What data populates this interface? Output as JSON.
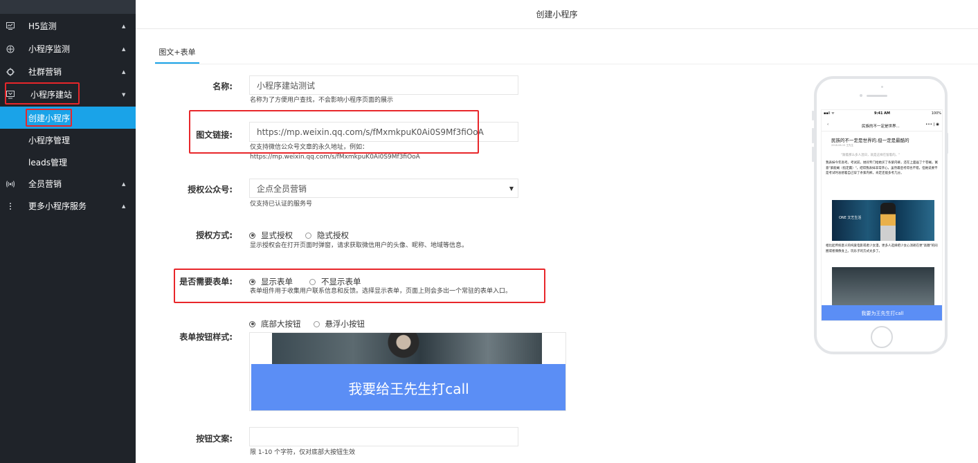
{
  "sidebar": {
    "items": [
      {
        "label": "H5监测",
        "icon": "monitor-chart-icon"
      },
      {
        "label": "小程序监测",
        "icon": "crosshair-icon"
      },
      {
        "label": "社群营销",
        "icon": "community-icon"
      },
      {
        "label": "小程序建站",
        "icon": "screen-icon"
      },
      {
        "label": "全员营销",
        "icon": "broadcast-icon"
      },
      {
        "label": "更多小程序服务",
        "icon": "more-vertical-icon"
      }
    ],
    "subitems": [
      {
        "label": "创建小程序",
        "active": true
      },
      {
        "label": "小程序管理",
        "active": false
      },
      {
        "label": "leads管理",
        "active": false
      }
    ],
    "active_color": "#1aa3e8",
    "highlight_color": "#e8262a"
  },
  "header": {
    "title": "创建小程序"
  },
  "tabs": [
    {
      "label": "图文+表单",
      "active": true
    }
  ],
  "form": {
    "name": {
      "label": "名称:",
      "value": "小程序建站测试",
      "hint": "名称为了方便用户查找，不会影响小程序页面的展示"
    },
    "link": {
      "label": "图文链接:",
      "value": "https://mp.weixin.qq.com/s/fMxmkpuK0Ai0S9Mf3fiOoA",
      "hint1": "仅支持微信公众号文章的永久地址，例如：",
      "hint2": "https://mp.weixin.qq.com/s/fMxmkpuK0Ai0S9Mf3fiOoA"
    },
    "account": {
      "label": "授权公众号:",
      "value": "企点全员营销",
      "hint": "仅支持已认证的服务号"
    },
    "auth_mode": {
      "label": "授权方式:",
      "options": [
        "显式授权",
        "隐式授权"
      ],
      "selected": "显式授权",
      "hint": "显示授权会在打开页面时弹窗，请求获取微信用户的头像、昵称、地域等信息。"
    },
    "need_form": {
      "label": "是否需要表单:",
      "options": [
        "显示表单",
        "不显示表单"
      ],
      "selected": "显示表单",
      "hint": "表单组件用于收集用户联系信息和反馈。选择显示表单，页面上则会多出一个常驻的表单入口。"
    },
    "button_style": {
      "label": "表单按钮样式:",
      "options": [
        "底部大按钮",
        "悬浮小按钮"
      ],
      "selected": "底部大按钮",
      "preview_text": "我要给王先生打call"
    },
    "button_text": {
      "label": "按钮文案:",
      "value": "",
      "hint": "限 1-10 个字符，仅对底部大按钮生效"
    }
  },
  "phone_preview": {
    "status_left": "▪▪ll ᯤ",
    "time": "9:41 AM",
    "battery": "100%",
    "nav_back": "‹",
    "nav_title": "民族的不一定是世界...",
    "nav_more": "••• | ◉",
    "article_title": "民族的不一定是世界的,但一定是最酷的",
    "article_date": "2018-06-15  王先生",
    "quote": "\"跟着那么多人混日，就是这样在留着的。\"",
    "para1": "我表妹今年高考。考试前，她问专门给她买了条紫内裤，还在上面画了个苍蝇，寓意\"紫能蝇（指定赢）\"，结得我表妹非常开心，虽然最后考得也不错，但她说要不是考试时总想着自己穿了条紫内裤，肯定还能多考几分。",
    "image_overlay": "ONE 文艺生活",
    "para2": "相比起传统意义的纯爱电影或者少女漫，更多人选择把少女心消耗在更\"高糖\"的同圈或者偶像身上。玩乐子的方式太多了。",
    "cta": "我要为王先生打call",
    "accent": "#5b8ef5"
  }
}
